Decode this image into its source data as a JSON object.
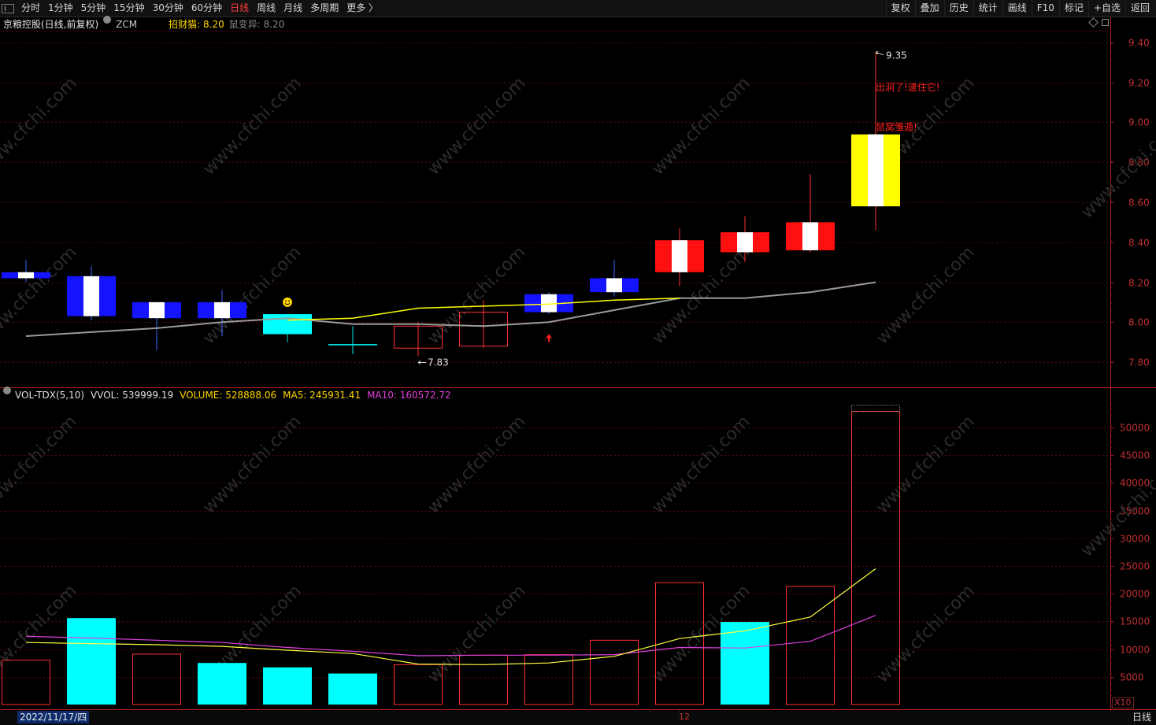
{
  "toolbar": {
    "left_items": [
      "分时",
      "1分钟",
      "5分钟",
      "15分钟",
      "30分钟",
      "60分钟",
      "日线",
      "周线",
      "月线",
      "多周期",
      "更多 〉"
    ],
    "active_item": "日线",
    "right_items": [
      "复权",
      "叠加",
      "历史",
      "统计",
      "画线",
      "F10",
      "标记",
      "+自选",
      "返回"
    ]
  },
  "price_panel": {
    "stock": "京粮控股(日线,前复权)",
    "indicator": "ZCM",
    "line1_label": "招财猫: 8.20",
    "line2_label": "鼠变异: 8.20",
    "high_mark": "9.35",
    "low_mark": "7.83",
    "annotation1": "出洞了!逮住它!",
    "annotation2": "鼠窝雏遁!"
  },
  "volume_panel": {
    "title": "VOL-TDX(5,10)",
    "vvol": "VVOL: 539999.19",
    "volume": "VOLUME: 528888.06",
    "ma5": "MA5: 245931.41",
    "ma10": "MA10: 160572.72",
    "multiplier": "X10"
  },
  "footer": {
    "date": "2022/11/17/四",
    "period_mark": "12",
    "cycle": "日线"
  },
  "colors": {
    "up": "#ff1a1a",
    "down_box": "#0000ff",
    "cyan": "#00ffff",
    "yellow": "#ffff00",
    "gray_line": "#a0a0a0",
    "magenta": "#e040e0",
    "axis_red": "#b02020"
  },
  "chart_data": [
    {
      "type": "candlestick",
      "y_ticks": [
        7.8,
        8.0,
        8.2,
        8.4,
        8.6,
        8.8,
        9.0,
        9.2,
        9.4
      ],
      "candles": [
        {
          "style": "blue",
          "open": 8.25,
          "close": 8.22,
          "high": 8.31,
          "low": 8.2
        },
        {
          "style": "blue",
          "open": 8.23,
          "close": 8.03,
          "high": 8.28,
          "low": 8.01
        },
        {
          "style": "blue",
          "open": 8.1,
          "close": 8.02,
          "high": 8.1,
          "low": 7.86
        },
        {
          "style": "blue",
          "open": 8.1,
          "close": 8.02,
          "high": 8.16,
          "low": 7.93
        },
        {
          "style": "cyan",
          "open": 8.04,
          "close": 7.94,
          "high": 8.04,
          "low": 7.9
        },
        {
          "style": "cyan",
          "open": 7.89,
          "close": 7.89,
          "high": 7.98,
          "low": 7.84
        },
        {
          "style": "hollow_red",
          "open": 7.87,
          "close": 7.98,
          "high": 8.0,
          "low": 7.83
        },
        {
          "style": "hollow_red",
          "open": 7.88,
          "close": 8.05,
          "high": 8.11,
          "low": 7.87
        },
        {
          "style": "blue",
          "open": 8.14,
          "close": 8.05,
          "high": 8.15,
          "low": 8.04
        },
        {
          "style": "blue",
          "open": 8.22,
          "close": 8.15,
          "high": 8.31,
          "low": 8.13
        },
        {
          "style": "red",
          "open": 8.25,
          "close": 8.41,
          "high": 8.47,
          "low": 8.18
        },
        {
          "style": "red",
          "open": 8.35,
          "close": 8.45,
          "high": 8.53,
          "low": 8.3
        },
        {
          "style": "red",
          "open": 8.36,
          "close": 8.5,
          "high": 8.74,
          "low": 8.35
        },
        {
          "style": "yellow",
          "open": 8.58,
          "close": 8.94,
          "high": 9.35,
          "low": 8.46
        }
      ],
      "yellow_line": [
        null,
        null,
        null,
        null,
        8.01,
        8.02,
        8.07,
        8.08,
        8.09,
        8.11,
        8.12,
        null,
        null,
        null
      ],
      "gray_line": [
        7.93,
        7.95,
        7.97,
        8.0,
        8.02,
        7.99,
        7.99,
        7.98,
        8.0,
        8.06,
        8.12,
        8.12,
        8.15,
        8.2
      ]
    },
    {
      "type": "bar",
      "y_ticks": [
        5000,
        10000,
        15000,
        20000,
        25000,
        30000,
        35000,
        40000,
        45000,
        50000
      ],
      "bars": [
        {
          "value": 8000,
          "style": "hollow_red"
        },
        {
          "value": 15600,
          "style": "cyan"
        },
        {
          "value": 9100,
          "style": "hollow_red"
        },
        {
          "value": 7500,
          "style": "cyan"
        },
        {
          "value": 6700,
          "style": "cyan"
        },
        {
          "value": 5600,
          "style": "cyan"
        },
        {
          "value": 7200,
          "style": "hollow_red"
        },
        {
          "value": 8900,
          "style": "hollow_red"
        },
        {
          "value": 9000,
          "style": "hollow_red"
        },
        {
          "value": 11600,
          "style": "hollow_red"
        },
        {
          "value": 22000,
          "style": "hollow_red"
        },
        {
          "value": 14900,
          "style": "cyan"
        },
        {
          "value": 21300,
          "style": "hollow_red"
        },
        {
          "value": 52900,
          "style": "hollow_red"
        }
      ],
      "ma5": [
        11200,
        11000,
        10800,
        10500,
        9800,
        9200,
        7300,
        7200,
        7500,
        8700,
        11900,
        13300,
        15800,
        24500
      ],
      "ma10": [
        12300,
        12000,
        11600,
        11200,
        10300,
        9600,
        8800,
        8900,
        8900,
        9000,
        10300,
        10200,
        11400,
        16100
      ]
    }
  ]
}
